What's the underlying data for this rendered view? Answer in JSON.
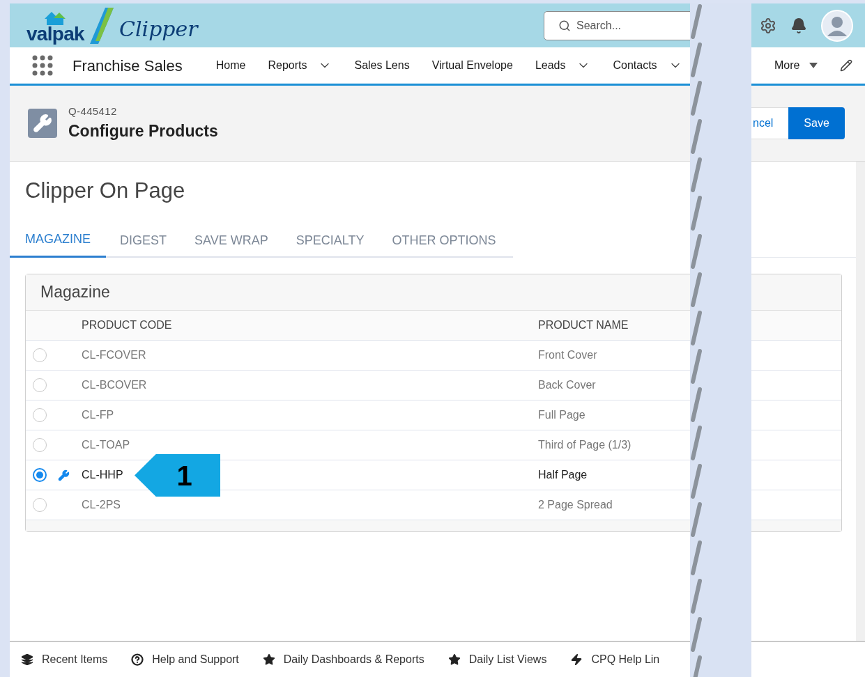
{
  "brand": {
    "logo_left": "valpak",
    "logo_right": "Clipper"
  },
  "search": {
    "placeholder": "Search..."
  },
  "app_name": "Franchise Sales",
  "nav": [
    {
      "label": "Home",
      "dropdown": false
    },
    {
      "label": "Reports",
      "dropdown": true
    },
    {
      "label": "Sales Lens",
      "dropdown": false
    },
    {
      "label": "Virtual Envelope",
      "dropdown": false
    },
    {
      "label": "Leads",
      "dropdown": true
    },
    {
      "label": "Contacts",
      "dropdown": true
    }
  ],
  "nav_more": "More",
  "record": {
    "id": "Q-445412",
    "title": "Configure Products"
  },
  "actions": [
    {
      "label": "ncel",
      "kind": "secondary"
    },
    {
      "label": "Save",
      "kind": "primary"
    }
  ],
  "section_title": "Clipper On Page",
  "tabs": [
    {
      "label": "MAGAZINE",
      "selected": true
    },
    {
      "label": "DIGEST",
      "selected": false
    },
    {
      "label": "SAVE WRAP",
      "selected": false
    },
    {
      "label": "SPECIALTY",
      "selected": false
    },
    {
      "label": "OTHER OPTIONS",
      "selected": false
    }
  ],
  "table": {
    "title": "Magazine",
    "columns": [
      "PRODUCT CODE",
      "PRODUCT NAME"
    ],
    "rows": [
      {
        "code": "CL-FCOVER",
        "name": "Front Cover",
        "selected": false
      },
      {
        "code": "CL-BCOVER",
        "name": "Back Cover",
        "selected": false
      },
      {
        "code": "CL-FP",
        "name": "Full Page",
        "selected": false
      },
      {
        "code": "CL-TOAP",
        "name": "Third of Page (1/3)",
        "selected": false
      },
      {
        "code": "CL-HHP",
        "name": "Half Page",
        "selected": true
      },
      {
        "code": "CL-2PS",
        "name": "2 Page Spread",
        "selected": false
      }
    ]
  },
  "callout": {
    "label": "1"
  },
  "utility_bar": [
    "Recent Items",
    "Help and Support",
    "Daily Dashboards & Reports",
    "Daily List Views",
    "CPQ Help Lin"
  ]
}
